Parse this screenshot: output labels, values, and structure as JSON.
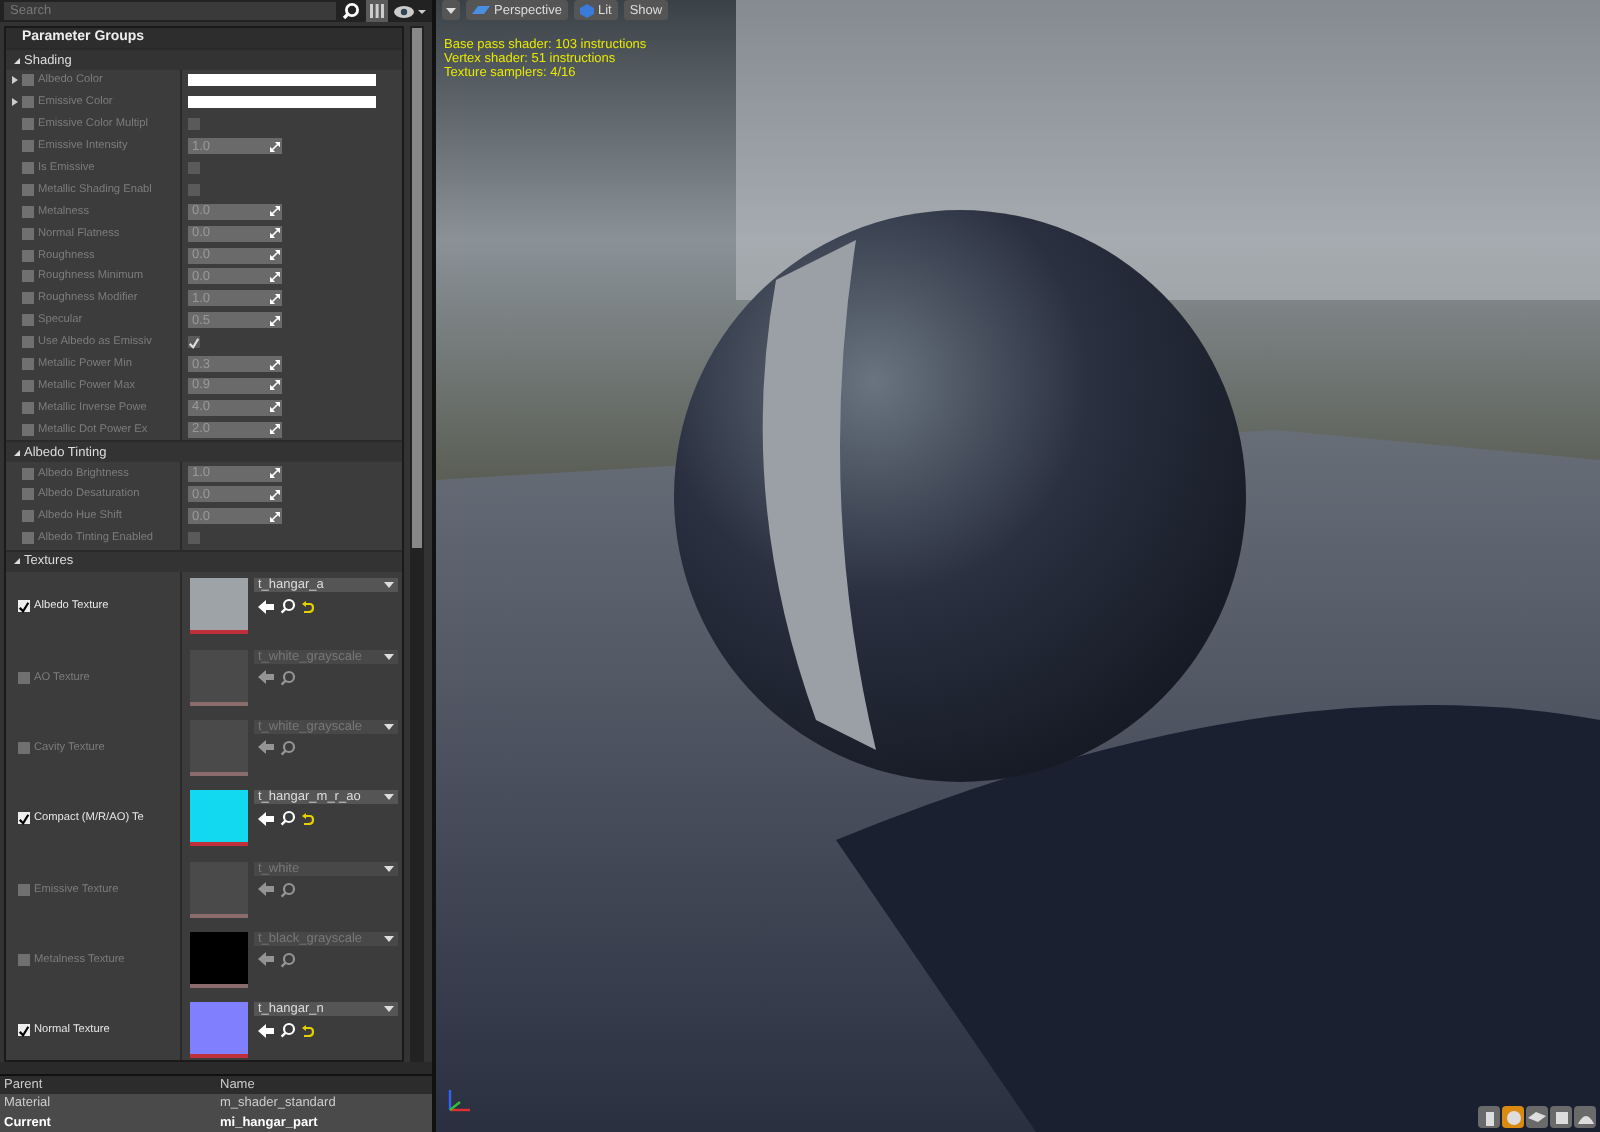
{
  "search": {
    "placeholder": "Search"
  },
  "panel_title": "Parameter Groups",
  "groups": [
    {
      "name": "Shading",
      "expanded": true,
      "params": [
        {
          "kind": "color",
          "label": "Albedo Color",
          "overridden": false,
          "expanded": false,
          "color": "#ffffff"
        },
        {
          "kind": "color",
          "label": "Emissive Color",
          "overridden": false,
          "expanded": false,
          "color": "#ffffff"
        },
        {
          "kind": "bool",
          "label": "Emissive Color Multipl",
          "overridden": false,
          "checked": false
        },
        {
          "kind": "scalar",
          "label": "Emissive Intensity",
          "overridden": false,
          "value": "1.0"
        },
        {
          "kind": "bool",
          "label": "Is Emissive",
          "overridden": false,
          "checked": false
        },
        {
          "kind": "bool",
          "label": "Metallic Shading Enabl",
          "overridden": false,
          "checked": false
        },
        {
          "kind": "scalar",
          "label": "Metalness",
          "overridden": false,
          "value": "0.0"
        },
        {
          "kind": "scalar",
          "label": "Normal Flatness",
          "overridden": false,
          "value": "0.0"
        },
        {
          "kind": "scalar",
          "label": "Roughness",
          "overridden": false,
          "value": "0.0"
        },
        {
          "kind": "scalar",
          "label": "Roughness Minimum",
          "overridden": false,
          "value": "0.0"
        },
        {
          "kind": "scalar",
          "label": "Roughness Modifier",
          "overridden": false,
          "value": "1.0"
        },
        {
          "kind": "scalar",
          "label": "Specular",
          "overridden": false,
          "value": "0.5"
        },
        {
          "kind": "bool",
          "label": "Use Albedo as Emissiv",
          "overridden": false,
          "checked": true
        },
        {
          "kind": "scalar",
          "label": "Metallic Power Min",
          "overridden": false,
          "value": "0.3"
        },
        {
          "kind": "scalar",
          "label": "Metallic Power Max",
          "overridden": false,
          "value": "0.9"
        },
        {
          "kind": "scalar",
          "label": "Metallic Inverse Powe",
          "overridden": false,
          "value": "4.0"
        },
        {
          "kind": "scalar",
          "label": "Metallic Dot Power Ex",
          "overridden": false,
          "value": "2.0"
        }
      ]
    },
    {
      "name": "Albedo Tinting",
      "expanded": true,
      "params": [
        {
          "kind": "scalar",
          "label": "Albedo Brightness",
          "overridden": false,
          "value": "1.0"
        },
        {
          "kind": "scalar",
          "label": "Albedo Desaturation",
          "overridden": false,
          "value": "0.0"
        },
        {
          "kind": "scalar",
          "label": "Albedo Hue Shift",
          "overridden": false,
          "value": "0.0"
        },
        {
          "kind": "bool",
          "label": "Albedo Tinting Enabled",
          "overridden": false,
          "checked": false
        }
      ]
    },
    {
      "name": "Textures",
      "expanded": true,
      "params": [
        {
          "kind": "texture",
          "label": "Albedo Texture",
          "overridden": true,
          "asset": "t_hangar_a",
          "color": "#9ea3a8"
        },
        {
          "kind": "texture",
          "label": "AO Texture",
          "overridden": false,
          "asset": "t_white_grayscale",
          "color": "#4a4a4a"
        },
        {
          "kind": "texture",
          "label": "Cavity Texture",
          "overridden": false,
          "asset": "t_white_grayscale",
          "color": "#4a4a4a"
        },
        {
          "kind": "texture",
          "label": "Compact (M/R/AO) Te",
          "overridden": true,
          "asset": "t_hangar_m_r_ao",
          "color": "#12d8f0"
        },
        {
          "kind": "texture",
          "label": "Emissive Texture",
          "overridden": false,
          "asset": "t_white",
          "color": "#4a4a4a"
        },
        {
          "kind": "texture",
          "label": "Metalness Texture",
          "overridden": false,
          "asset": "t_black_grayscale",
          "color": "#000000"
        },
        {
          "kind": "texture",
          "label": "Normal Texture",
          "overridden": true,
          "asset": "t_hangar_n",
          "color": "#8080ff"
        }
      ]
    }
  ],
  "table": {
    "columns": [
      "Parent",
      "Name"
    ],
    "rows": [
      {
        "cells": [
          "Material",
          "m_shader_standard"
        ],
        "current": false
      },
      {
        "cells": [
          "Current",
          "mi_hangar_part"
        ],
        "current": true
      }
    ]
  },
  "viewport": {
    "buttons": [
      {
        "kind": "perspective",
        "label": "Perspective"
      },
      {
        "kind": "lit",
        "label": "Lit"
      },
      {
        "kind": "plain",
        "label": "Show"
      }
    ],
    "stats": [
      "Base pass shader: 103 instructions",
      "Vertex shader: 51 instructions",
      "Texture samplers: 4/16"
    ],
    "preview_shapes": [
      {
        "kind": "cylinder",
        "selected": false
      },
      {
        "kind": "sphere",
        "selected": true
      },
      {
        "kind": "plane",
        "selected": false
      },
      {
        "kind": "cube",
        "selected": false
      },
      {
        "kind": "mesh",
        "selected": false
      }
    ]
  }
}
